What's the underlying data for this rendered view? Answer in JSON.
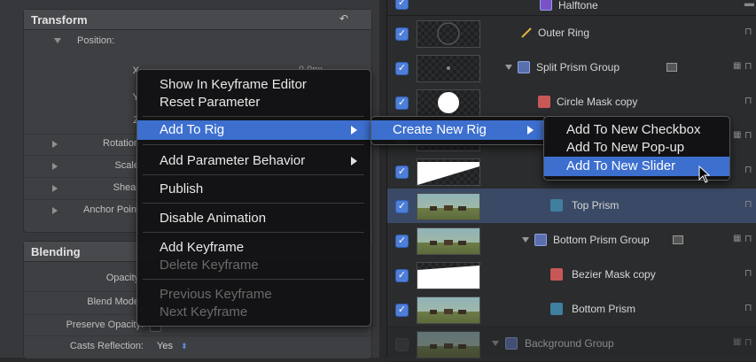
{
  "inspector": {
    "transform": {
      "title": "Transform",
      "position_label": "Position:",
      "x_label": "X",
      "x_value": "0.0px",
      "y_label": "Y",
      "z_label": "Z",
      "rotation_label": "Rotation",
      "scale_label": "Scale",
      "shear_label": "Shear",
      "anchor_label": "Anchor Point"
    },
    "blending": {
      "title": "Blending",
      "opacity_label": "Opacity",
      "blend_mode_label": "Blend Mode",
      "preserve_opacity_label": "Preserve Opacity:",
      "casts_reflection_label": "Casts Reflection:",
      "casts_reflection_value": "Yes"
    }
  },
  "context_menu": {
    "items": [
      "Show In Keyframe Editor",
      "Reset Parameter",
      "Add To Rig",
      "Add Parameter Behavior",
      "Publish",
      "Disable Animation",
      "Add Keyframe",
      "Delete Keyframe",
      "Previous Keyframe",
      "Next Keyframe"
    ]
  },
  "rig_submenu": {
    "create_new_rig": "Create New Rig"
  },
  "widget_submenu": {
    "checkbox": "Add To New Checkbox",
    "popup": "Add To New Pop-up",
    "slider": "Add To New Slider"
  },
  "layers": [
    {
      "name": "Halftone",
      "checked": true
    },
    {
      "name": "Outer Ring",
      "checked": true
    },
    {
      "name": "Split Prism Group",
      "checked": true
    },
    {
      "name": "Circle Mask copy",
      "checked": true
    },
    {
      "name": "",
      "checked": true
    },
    {
      "name": "",
      "checked": true
    },
    {
      "name": "Top Prism",
      "checked": true
    },
    {
      "name": "Bottom Prism Group",
      "checked": true
    },
    {
      "name": "Bezier Mask copy",
      "checked": true
    },
    {
      "name": "Bottom Prism",
      "checked": true
    },
    {
      "name": "Background Group",
      "checked": false
    }
  ],
  "colors": {
    "menu_highlight": "#3d6fcf",
    "checkbox_blue": "#4f7ed6",
    "selected_row": "#3a4a66"
  }
}
